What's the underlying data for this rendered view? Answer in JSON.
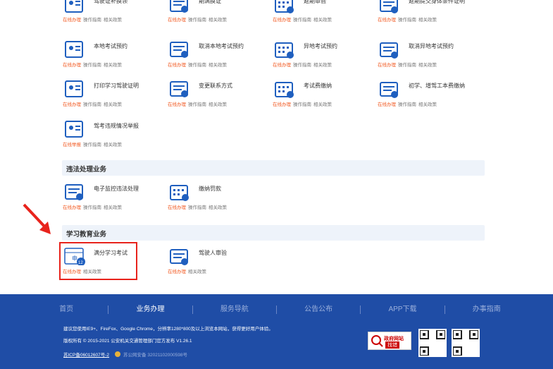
{
  "rows": [
    [
      {
        "name": "驾驶证补换领",
        "links": [
          "在线办理",
          "操作指南",
          "相关政策"
        ]
      },
      {
        "name": "期满换证",
        "links": [
          "在线办理",
          "操作指南",
          "相关政策"
        ]
      },
      {
        "name": "延期审验",
        "links": [
          "在线办理",
          "操作指南",
          "相关政策"
        ]
      },
      {
        "name": "延期提交身体条件证明",
        "links": [
          "在线办理",
          "操作指南",
          "相关政策"
        ]
      }
    ],
    [
      {
        "name": "本地考试预约",
        "links": [
          "在线办理",
          "操作指南",
          "相关政策"
        ]
      },
      {
        "name": "取消本地考试预约",
        "links": [
          "在线办理",
          "操作指南",
          "相关政策"
        ]
      },
      {
        "name": "异地考试预约",
        "links": [
          "在线办理",
          "操作指南",
          "相关政策"
        ]
      },
      {
        "name": "取消异地考试预约",
        "links": [
          "在线办理",
          "操作指南",
          "相关政策"
        ]
      }
    ],
    [
      {
        "name": "打印学习驾驶证明",
        "links": [
          "在线办理",
          "操作指南",
          "相关政策"
        ]
      },
      {
        "name": "变更联系方式",
        "links": [
          "在线办理",
          "操作指南",
          "相关政策"
        ]
      },
      {
        "name": "考试费缴纳",
        "links": [
          "在线办理",
          "操作指南",
          "相关政策"
        ]
      },
      {
        "name": "初学、增驾工本费缴纳",
        "links": [
          "在线办理",
          "操作指南",
          "相关政策"
        ]
      }
    ],
    [
      {
        "name": "驾考违规情况举报",
        "links": [
          "在线举报",
          "操作指南",
          "相关政策"
        ]
      }
    ]
  ],
  "section_violation": {
    "title": "违法处理业务",
    "items": [
      {
        "name": "电子监控违法处理",
        "links": [
          "在线办理",
          "操作指南",
          "相关政策"
        ]
      },
      {
        "name": "缴纳罚款",
        "links": [
          "在线办理",
          "操作指南",
          "相关政策"
        ]
      }
    ]
  },
  "section_education": {
    "title": "学习教育业务",
    "items": [
      {
        "name": "满分学习考试",
        "links": [
          "在线办理",
          "相关政策"
        ],
        "icon_text": "申",
        "badge": "12"
      },
      {
        "name": "驾驶人审验",
        "links": [
          "在线办理",
          "相关政策"
        ]
      }
    ]
  },
  "footer": {
    "nav": [
      "首页",
      "业务办理",
      "服务导航",
      "公告公布",
      "APP下载",
      "办事指南"
    ],
    "active": "业务办理",
    "notice": "建议您使用IE9+、FireFox、Google Chrome，分辨率1280*800及以上浏览本网站，获得更好用户体验。",
    "copyright": "版权所有 © 2015-2021 公安机关交通管理部门官方发布 V1.26.1",
    "icp": "苏ICP备06012607号-2",
    "police": "苏公网安备 32021102000598号",
    "gov_badge_top": "政府网站",
    "gov_badge_bottom": "找错"
  },
  "colors": {
    "accent": "#1f5fbf",
    "orange": "#f25a22",
    "footer_bg": "#1f4da6",
    "highlight": "#e8231c"
  }
}
